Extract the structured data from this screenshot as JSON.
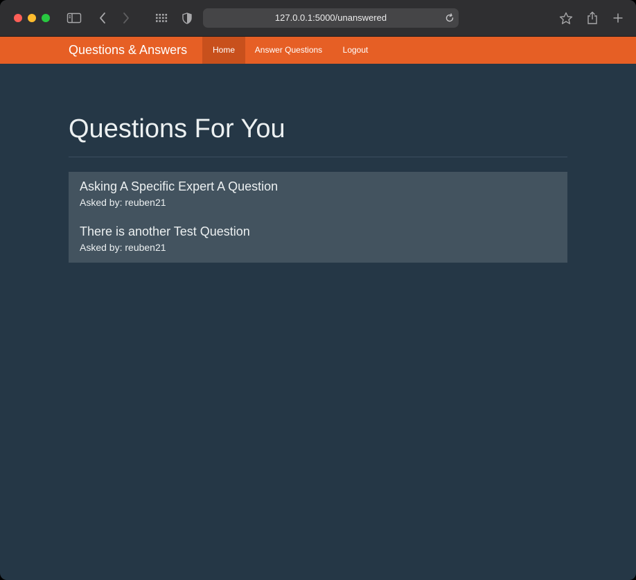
{
  "browser": {
    "url": "127.0.0.1:5000/unanswered"
  },
  "navbar": {
    "brand": "Questions & Answers",
    "items": [
      {
        "label": "Home",
        "active": true
      },
      {
        "label": "Answer Questions",
        "active": false
      },
      {
        "label": "Logout",
        "active": false
      }
    ]
  },
  "main": {
    "title": "Questions For You",
    "questions": [
      {
        "title": "Asking A Specific Expert A Question",
        "asked_by": "Asked by: reuben21"
      },
      {
        "title": "There is another Test Question",
        "asked_by": "Asked by: reuben21"
      }
    ]
  },
  "colors": {
    "navbar": "#e65f25",
    "navbar_active": "#c8501c",
    "background": "#253746",
    "panel": "#43535f",
    "text": "#ecf0f1"
  },
  "icons": [
    "sidebar-toggle-icon",
    "back-icon",
    "forward-icon",
    "tab-grid-icon",
    "privacy-shield-icon",
    "reload-icon",
    "bookmark-star-icon",
    "share-icon",
    "new-tab-icon"
  ]
}
